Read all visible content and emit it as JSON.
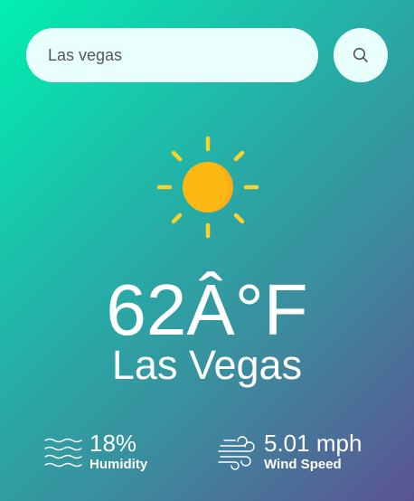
{
  "search": {
    "value": "Las vegas",
    "placeholder": "",
    "button_icon": "search-icon"
  },
  "weather": {
    "icon": "sun-icon",
    "temperature": "62Â°F",
    "city": "Las Vegas"
  },
  "stats": {
    "humidity": {
      "icon": "humidity-waves-icon",
      "value": "18%",
      "label": "Humidity"
    },
    "wind": {
      "icon": "wind-icon",
      "value": "5.01 mph",
      "label": "Wind Speed"
    }
  },
  "colors": {
    "gradient_start": "#00f0b0",
    "gradient_end": "#5b5393",
    "input_background": "#e9fffb",
    "sun_body": "#fdb813",
    "sun_rays": "#fcd12a"
  }
}
